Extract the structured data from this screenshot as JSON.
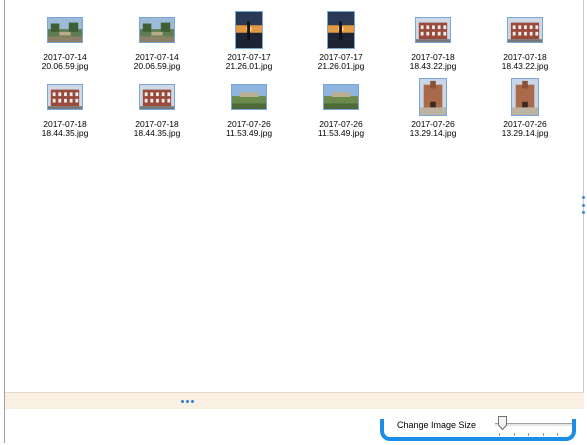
{
  "gallery": {
    "images": [
      {
        "filename": "2017-07-14\n20.06.59.jpg",
        "orientation": "landscape",
        "icon": "park-photo-icon"
      },
      {
        "filename": "2017-07-14\n20.06.59.jpg",
        "orientation": "landscape",
        "icon": "park-photo-icon"
      },
      {
        "filename": "2017-07-17\n21.26.01.jpg",
        "orientation": "portrait",
        "icon": "sunset-photo-icon"
      },
      {
        "filename": "2017-07-17\n21.26.01.jpg",
        "orientation": "portrait",
        "icon": "sunset-photo-icon"
      },
      {
        "filename": "2017-07-18\n18.43.22.jpg",
        "orientation": "landscape",
        "icon": "building-photo-icon"
      },
      {
        "filename": "2017-07-18\n18.43.22.jpg",
        "orientation": "landscape",
        "icon": "building-photo-icon"
      },
      {
        "filename": "2017-07-18\n18.44.35.jpg",
        "orientation": "landscape",
        "icon": "building-photo-icon"
      },
      {
        "filename": "2017-07-18\n18.44.35.jpg",
        "orientation": "landscape",
        "icon": "building-photo-icon"
      },
      {
        "filename": "2017-07-26\n11.53.49.jpg",
        "orientation": "landscape",
        "icon": "landscape-photo-icon"
      },
      {
        "filename": "2017-07-26\n11.53.49.jpg",
        "orientation": "landscape",
        "icon": "landscape-photo-icon"
      },
      {
        "filename": "2017-07-26\n13.29.14.jpg",
        "orientation": "portrait",
        "icon": "church-photo-icon"
      },
      {
        "filename": "2017-07-26\n13.29.14.jpg",
        "orientation": "portrait",
        "icon": "church-photo-icon"
      }
    ]
  },
  "footer": {
    "change_size_label": "Change Image Size",
    "image_size_value": 0,
    "accent_color": "#1a8ee6"
  }
}
